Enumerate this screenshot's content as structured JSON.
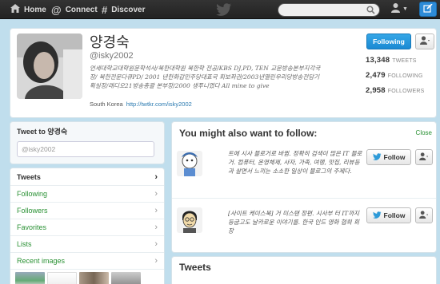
{
  "topbar": {
    "home": "Home",
    "connect": "Connect",
    "discover": "Discover"
  },
  "profile": {
    "name": "양경숙",
    "handle": "@isky2002",
    "bio": "언세대학교대학원문학석사/북한대학원 북한학 전공/KBS DJ,PD, TEN 교문방송본부지각국장/ 북한전문다큐PD/ 2001 년한화갑민주당대표국 회보좌관/2003년열린우리당방송전담기획실장/래디오21방송총괄 본부장/2000 생푸니였다 All mine to give",
    "location": "South Korea",
    "url": "http://twtkr.com/isky2002",
    "follow_button": "Following",
    "stats": [
      {
        "value": "13,348",
        "label": "TWEETS"
      },
      {
        "value": "2,479",
        "label": "FOLLOWING"
      },
      {
        "value": "2,958",
        "label": "FOLLOWERS"
      }
    ]
  },
  "tweet_box": {
    "title": "Tweet to 양경숙",
    "placeholder": "@isky2002"
  },
  "menu": {
    "items": [
      "Tweets",
      "Following",
      "Followers",
      "Favorites",
      "Lists",
      "Recent images"
    ]
  },
  "who_to_follow": {
    "title": "You might also want to follow:",
    "close": "Close",
    "suggestions": [
      {
        "bio": "트에 시사 블로거로 바뀜. 정확히 검색이 많은 IT 블로거. 컴퓨터, 온영체제, 사자, 가족, 여행, 맛집, 리뷰등과 살면서 느끼는 소소한 일상이 블로그의 주제다.",
        "follow": "Follow"
      },
      {
        "bio": "[사이트 케이스북] 거 미스탠 장편. 시사부 터 IT까지 등굽고도 날카로운 이야기를. 한국 인드 영화 협희 회장",
        "follow": "Follow"
      }
    ]
  },
  "tweets_panel": {
    "title": "Tweets"
  },
  "colors": {
    "background": "#c0deed",
    "link": "#2a9134",
    "follow_blue": "#1b8ad3"
  }
}
